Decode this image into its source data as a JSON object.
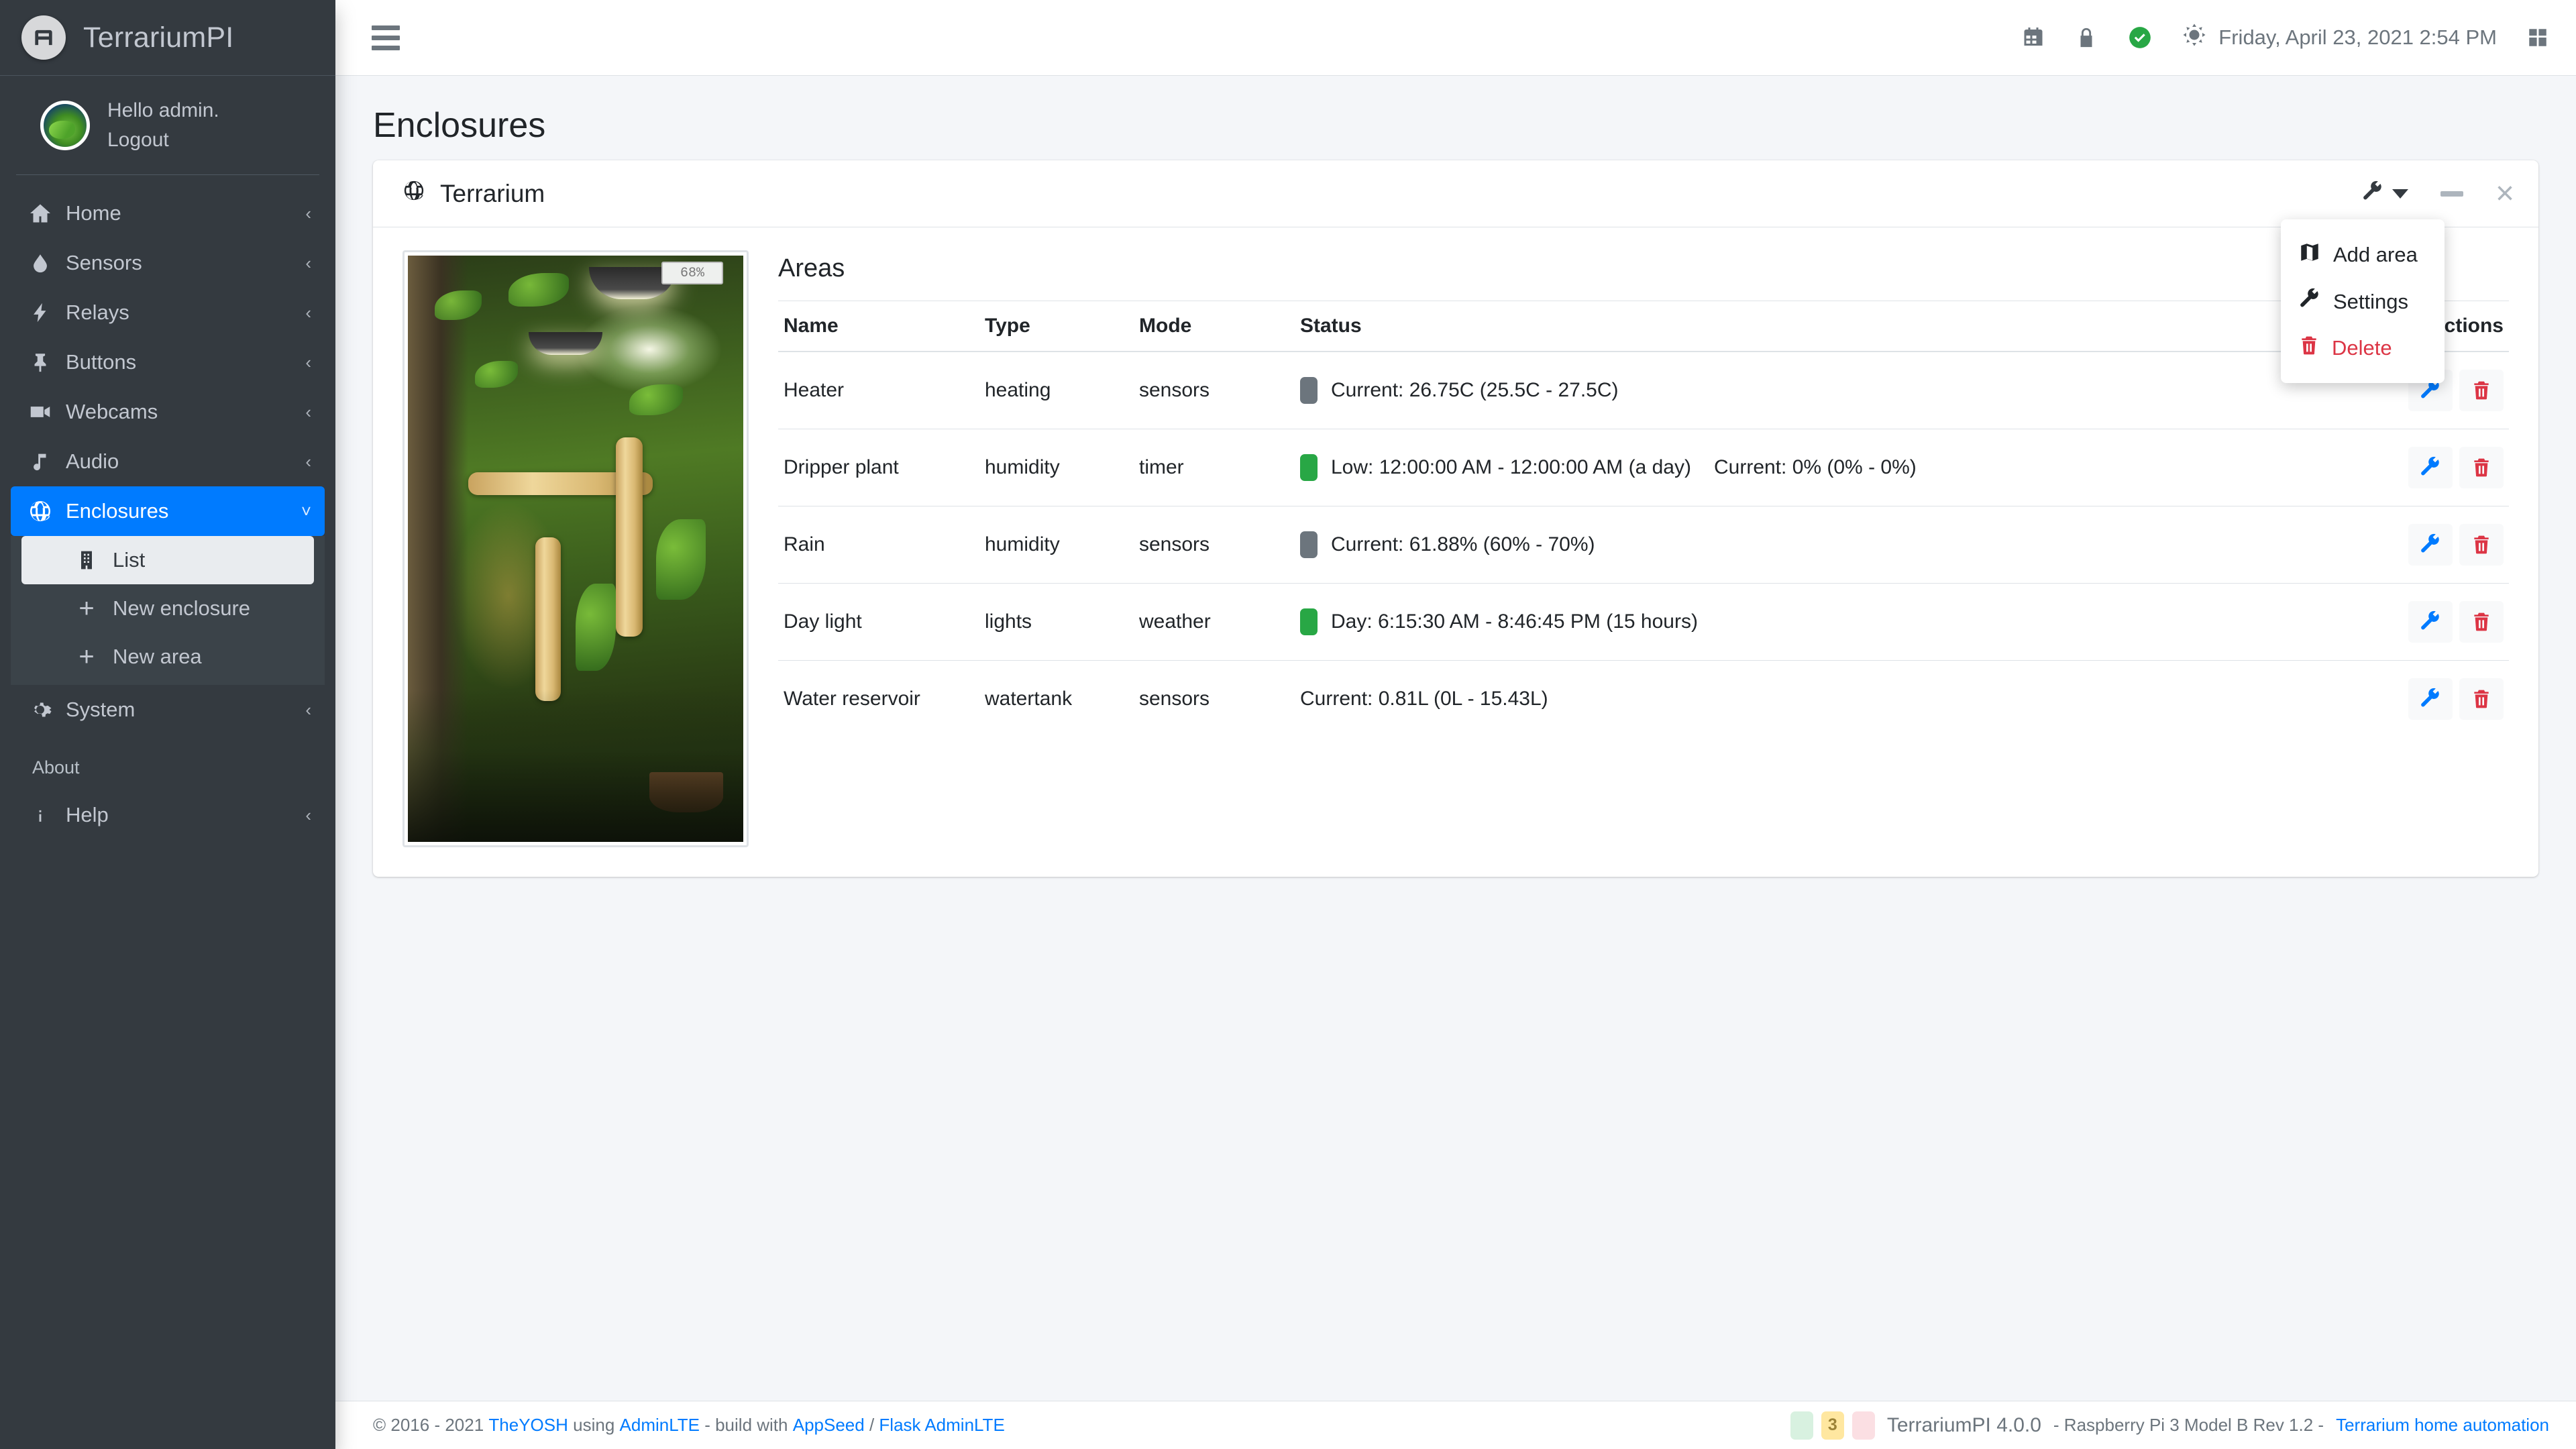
{
  "brand": {
    "title": "TerrariumPI",
    "logo_icon": "terrarium-logo-icon"
  },
  "user": {
    "greeting": "Hello admin.",
    "logout": "Logout"
  },
  "sidebar": {
    "items": [
      {
        "label": "Home",
        "icon": "home-icon",
        "arrow": "‹"
      },
      {
        "label": "Sensors",
        "icon": "water-drop-icon",
        "arrow": "‹"
      },
      {
        "label": "Relays",
        "icon": "bolt-icon",
        "arrow": "‹"
      },
      {
        "label": "Buttons",
        "icon": "thumbtack-icon",
        "arrow": "‹"
      },
      {
        "label": "Webcams",
        "icon": "video-camera-icon",
        "arrow": "‹"
      },
      {
        "label": "Audio",
        "icon": "music-note-icon",
        "arrow": "‹"
      },
      {
        "label": "Enclosures",
        "icon": "globe-icon",
        "arrow": "˅"
      },
      {
        "label": "System",
        "icon": "gear-icon",
        "arrow": "‹"
      }
    ],
    "sub_items": [
      {
        "label": "List",
        "icon": "building-icon"
      },
      {
        "label": "New enclosure",
        "icon": "plus-icon"
      },
      {
        "label": "New area",
        "icon": "plus-icon"
      }
    ],
    "about_header": "About",
    "help": {
      "label": "Help",
      "icon": "info-icon",
      "arrow": "‹"
    }
  },
  "navbar": {
    "menu_toggle": "hamburger-icon",
    "icons": [
      "calendar-icon",
      "lock-icon",
      "check-circle-icon"
    ],
    "datetime": "Friday, April 23, 2021 2:54 PM",
    "date_icon": "sun-icon",
    "grid_icon": "grid-icon"
  },
  "page": {
    "title": "Enclosures"
  },
  "card": {
    "title": "Terrarium",
    "title_icon": "globe-icon",
    "tools": {
      "wrench": "wrench-icon",
      "caret": "caret-down-icon",
      "minimize": "minimize-icon",
      "close": "close-icon"
    }
  },
  "dropdown": {
    "items": [
      {
        "label": "Add area",
        "icon": "map-icon",
        "danger": false
      },
      {
        "label": "Settings",
        "icon": "wrench-icon",
        "danger": false
      },
      {
        "label": "Delete",
        "icon": "trash-icon",
        "danger": true
      }
    ]
  },
  "photo": {
    "meter_value": "68%"
  },
  "areas": {
    "title": "Areas",
    "columns": [
      "Name",
      "Type",
      "Mode",
      "Status",
      "Actions"
    ],
    "rows": [
      {
        "name": "Heater",
        "type": "heating",
        "mode": "sensors",
        "indicator": "gray",
        "status_parts": [
          "Current: 26.75C (25.5C - 27.5C)"
        ],
        "edit_icon": "wrench-icon",
        "delete_icon": "trash-icon"
      },
      {
        "name": "Dripper plant",
        "type": "humidity",
        "mode": "timer",
        "indicator": "green",
        "status_parts": [
          "Low: 12:00:00 AM - 12:00:00 AM (a day)",
          "Current: 0% (0% - 0%)"
        ],
        "edit_icon": "wrench-icon",
        "delete_icon": "trash-icon"
      },
      {
        "name": "Rain",
        "type": "humidity",
        "mode": "sensors",
        "indicator": "gray",
        "status_parts": [
          "Current: 61.88% (60% - 70%)"
        ],
        "edit_icon": "wrench-icon",
        "delete_icon": "trash-icon"
      },
      {
        "name": "Day light",
        "type": "lights",
        "mode": "weather",
        "indicator": "green",
        "status_parts": [
          "Day: 6:15:30 AM - 8:46:45 PM (15 hours)"
        ],
        "edit_icon": "wrench-icon",
        "delete_icon": "trash-icon"
      },
      {
        "name": "Water reservoir",
        "type": "watertank",
        "mode": "sensors",
        "indicator": "none",
        "status_parts": [
          "Current: 0.81L (0L - 15.43L)"
        ],
        "edit_icon": "wrench-icon",
        "delete_icon": "trash-icon"
      }
    ]
  },
  "footer": {
    "copyright": "© 2016 - 2021",
    "author": "TheYOSH",
    "using": "using",
    "adminlte": "AdminLTE",
    "build_with": "- build with",
    "appseed": "AppSeed",
    "slash": "/",
    "flask_adminlte": "Flask AdminLTE",
    "badges": [
      {
        "value": "",
        "color": "green"
      },
      {
        "value": "3",
        "color": "yellow"
      },
      {
        "value": "",
        "color": "red"
      }
    ],
    "version": "TerrariumPI 4.0.0",
    "hardware": "- Raspberry Pi 3 Model B Rev 1.2 -",
    "link": "Terrarium home automation"
  },
  "colors": {
    "sidebar_bg": "#343a40",
    "accent": "#007bff",
    "status_green": "#28a745",
    "status_gray": "#6c757d",
    "danger": "#dc3545",
    "content_bg": "#f4f6f9"
  }
}
